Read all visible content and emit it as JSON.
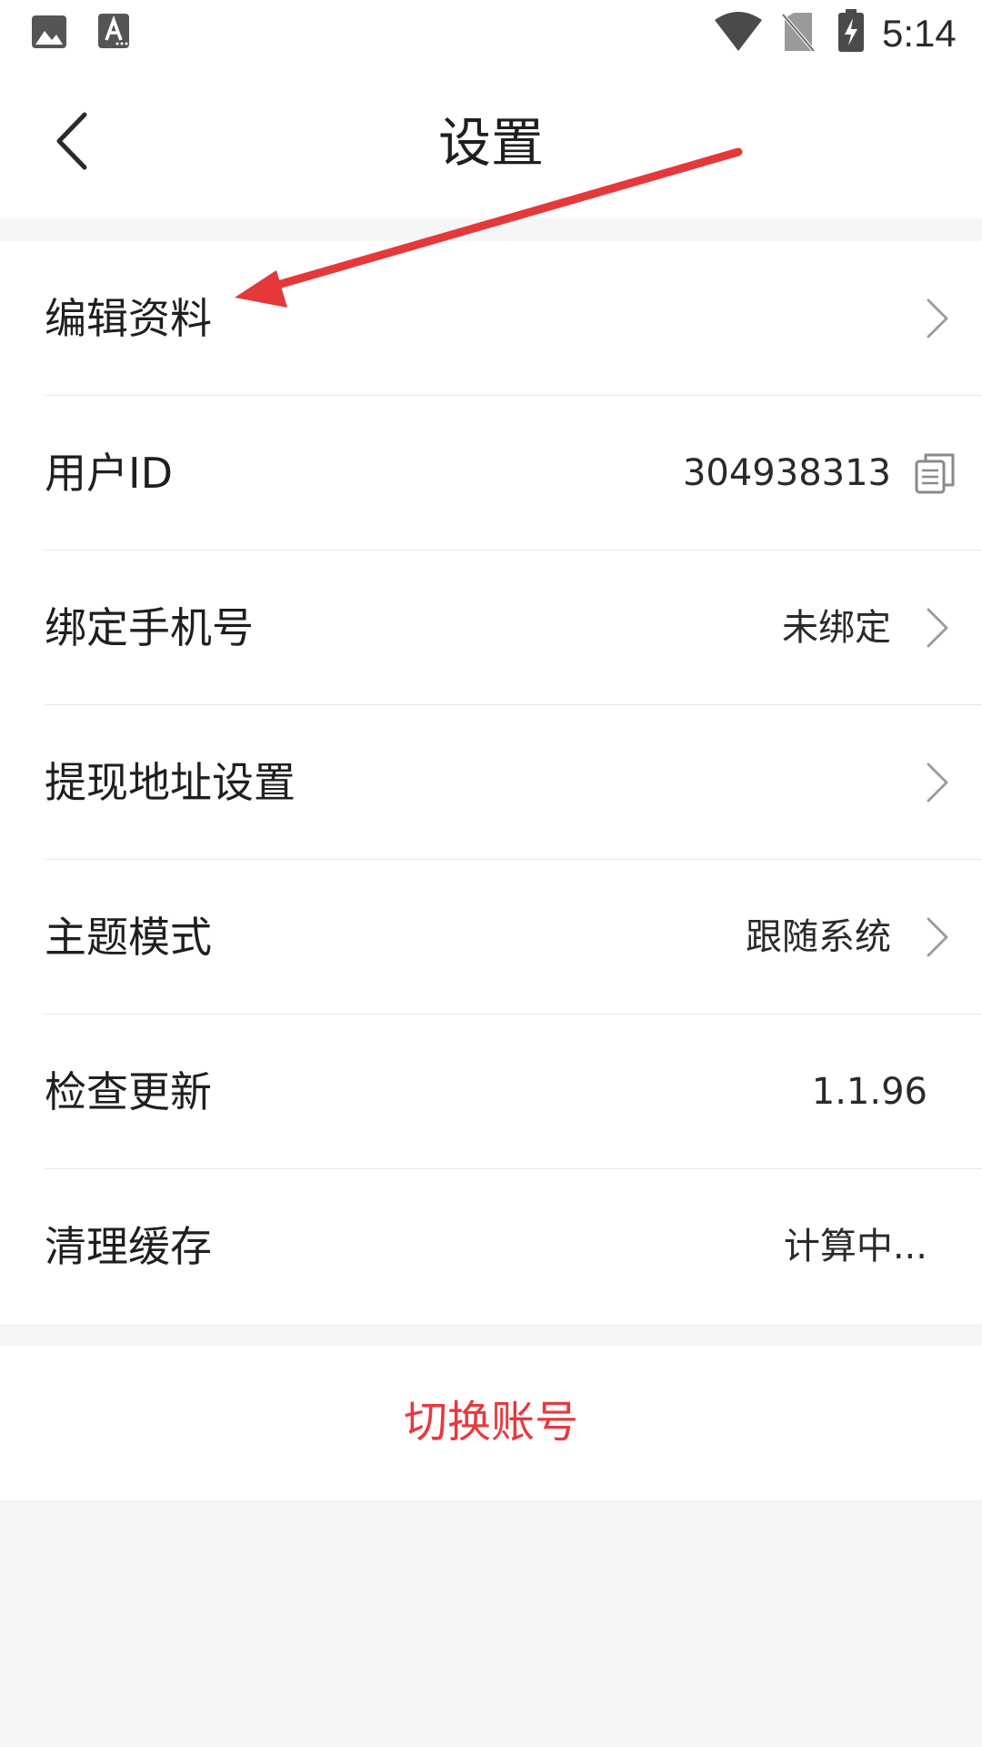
{
  "status_bar": {
    "time": "5:14",
    "icons": [
      "gallery-icon",
      "text-a-icon",
      "wifi-icon",
      "no-sim-icon",
      "battery-charging-icon"
    ]
  },
  "header": {
    "title": "设置",
    "back_icon": "chevron-left-icon"
  },
  "settings": {
    "edit_profile": {
      "label": "编辑资料"
    },
    "user_id": {
      "label": "用户ID",
      "value": "304938313"
    },
    "bind_phone": {
      "label": "绑定手机号",
      "value": "未绑定"
    },
    "withdraw_address": {
      "label": "提现地址设置"
    },
    "theme_mode": {
      "label": "主题模式",
      "value": "跟随系统"
    },
    "check_update": {
      "label": "检查更新",
      "value": "1.1.96"
    },
    "clear_cache": {
      "label": "清理缓存",
      "value": "计算中..."
    }
  },
  "switch_account": {
    "label": "切换账号"
  },
  "colors": {
    "accent_red": "#e8393e",
    "annotation_arrow": "#e5383b",
    "background": "#f5f6f6",
    "card": "#ffffff"
  }
}
